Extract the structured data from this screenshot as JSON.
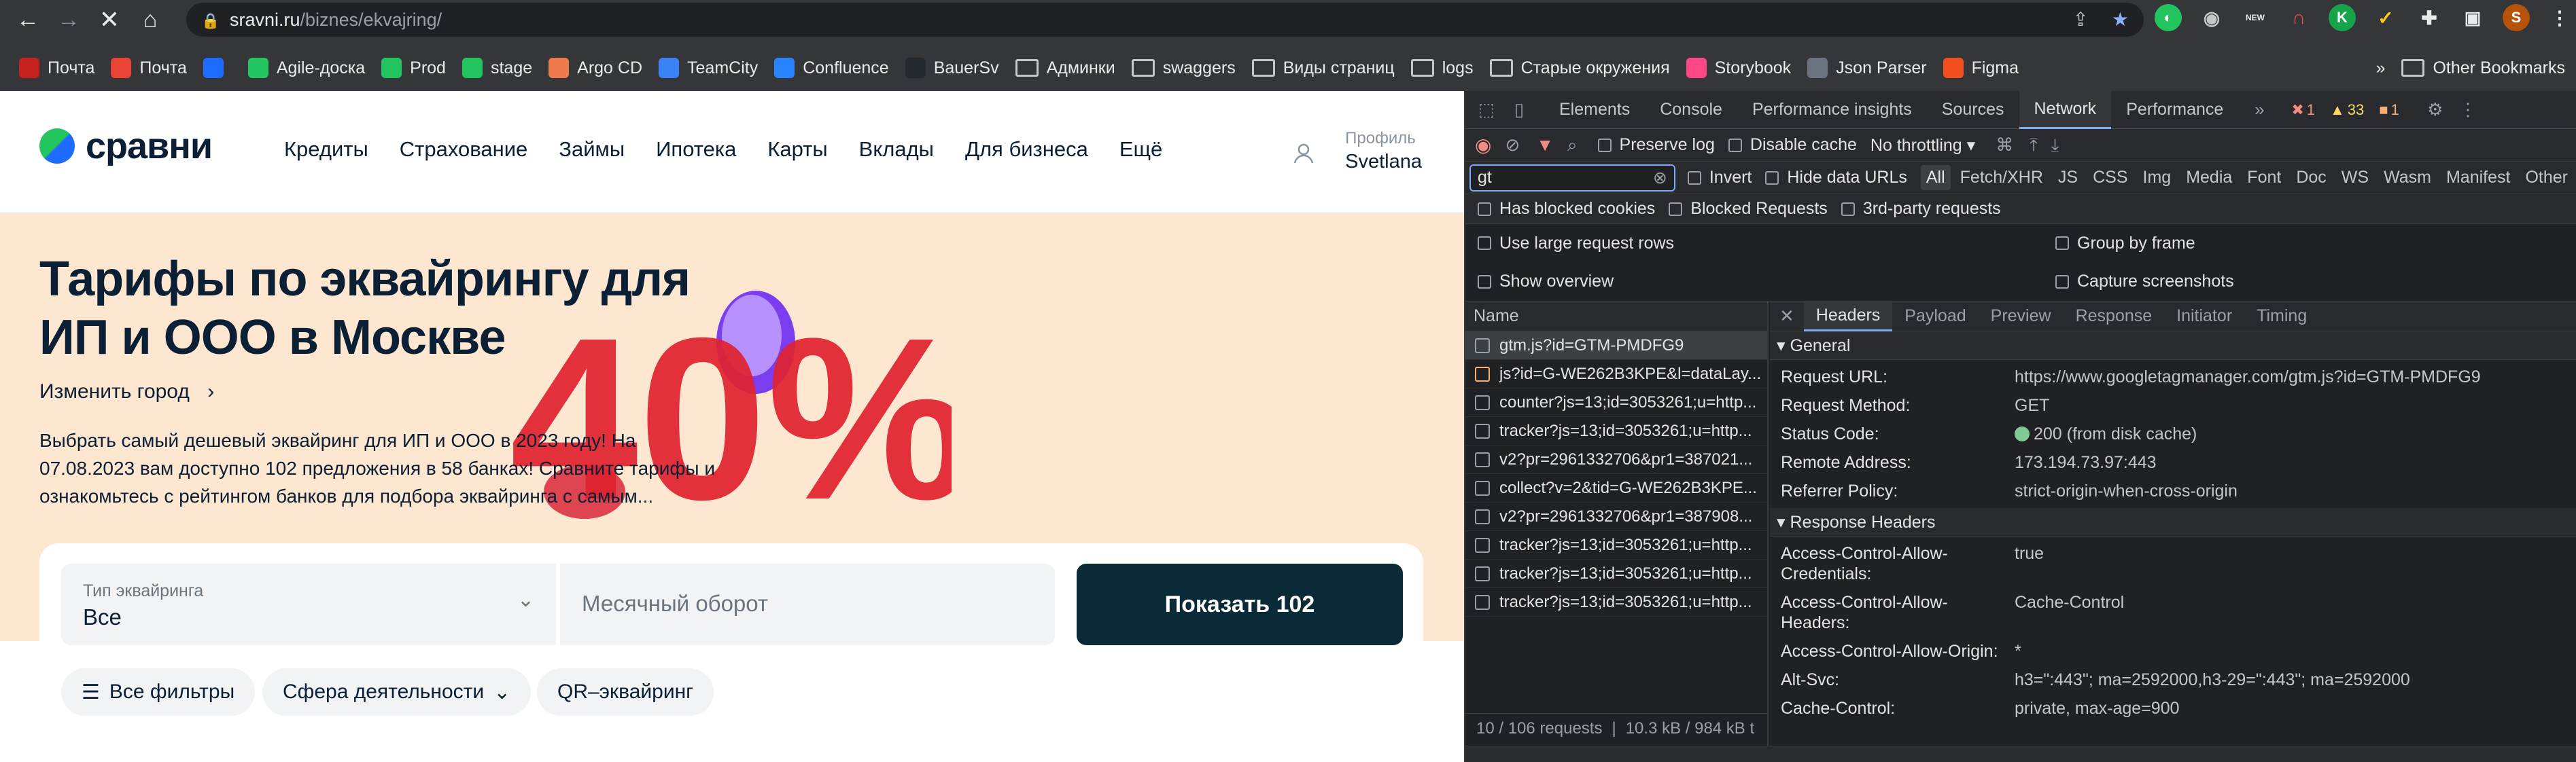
{
  "browser": {
    "url_host": "sravni.ru",
    "url_path": "/biznes/ekvajring/",
    "bookmarks": [
      {
        "label": "Почта",
        "color": "#c5221f",
        "icon": "gmail-icon"
      },
      {
        "label": "Почта",
        "color": "#ea4335",
        "icon": "gmail-icon"
      },
      {
        "label": "",
        "color": "#1e6bff",
        "icon": "jira-icon"
      },
      {
        "label": "Agile-доска",
        "color": "#22c55e",
        "icon": "sravni-icon"
      },
      {
        "label": "Prod",
        "color": "#22c55e",
        "icon": "sravni-icon"
      },
      {
        "label": "stage",
        "color": "#22c55e",
        "icon": "sravni-icon"
      },
      {
        "label": "Argo CD",
        "color": "#ef7b4d",
        "icon": "argo-icon"
      },
      {
        "label": "TeamCity",
        "color": "#3b82f6",
        "icon": "teamcity-icon"
      },
      {
        "label": "Confluence",
        "color": "#2684ff",
        "icon": "confluence-icon"
      },
      {
        "label": "BauerSv",
        "color": "#24292f",
        "icon": "github-icon"
      },
      {
        "label": "Админки",
        "color": "",
        "icon": "folder-icon"
      },
      {
        "label": "swaggers",
        "color": "",
        "icon": "folder-icon"
      },
      {
        "label": "Виды страниц",
        "color": "",
        "icon": "folder-icon"
      },
      {
        "label": "logs",
        "color": "",
        "icon": "folder-icon"
      },
      {
        "label": "Старые окружения",
        "color": "",
        "icon": "folder-icon"
      },
      {
        "label": "Storybook",
        "color": "#ff4785",
        "icon": "storybook-icon"
      },
      {
        "label": "Json Parser",
        "color": "#6b7280",
        "icon": "json-icon"
      },
      {
        "label": "Figma",
        "color": "#f24e1e",
        "icon": "figma-icon"
      }
    ],
    "more_bookmarks": "»",
    "other_bookmarks": "Other Bookmarks"
  },
  "site": {
    "logo": "сравни",
    "nav": [
      "Кредиты",
      "Страхование",
      "Займы",
      "Ипотека",
      "Карты",
      "Вклады",
      "Для бизнеса",
      "Ещё"
    ],
    "profile_label": "Профиль",
    "profile_name": "Svetlana",
    "hero_title": "Тарифы по эквайрингу для ИП и ООО в Москве",
    "change_city": "Изменить город",
    "hero_desc": "Выбрать самый дешевый эквайринг для ИП и ООО в 2023 году! На 07.08.2023 вам доступно 102 предложения в 58 банках! Сравните тарифы и ознакомьтесь с рейтингом банков для подбора эквайринга с самым...",
    "promo_text": "40%",
    "field_type_label": "Тип эквайринга",
    "field_type_value": "Все",
    "turnover_placeholder": "Месячный оборот",
    "show_button": "Показать 102",
    "chips": [
      "Все фильтры",
      "Сфера деятельности",
      "QR–эквайринг"
    ]
  },
  "devtools": {
    "tabs": [
      "Elements",
      "Console",
      "Performance insights",
      "Sources",
      "Network",
      "Performance"
    ],
    "active_tab": "Network",
    "errors": "1",
    "warnings": "33",
    "info": "1",
    "preserve_log": "Preserve log",
    "disable_cache": "Disable cache",
    "throttling": "No throttling",
    "filter_value": "gt",
    "invert": "Invert",
    "hide_data_urls": "Hide data URLs",
    "types": [
      "All",
      "Fetch/XHR",
      "JS",
      "CSS",
      "Img",
      "Media",
      "Font",
      "Doc",
      "WS",
      "Wasm",
      "Manifest",
      "Other"
    ],
    "has_blocked_cookies": "Has blocked cookies",
    "blocked_requests": "Blocked Requests",
    "third_party": "3rd-party requests",
    "large_rows": "Use large request rows",
    "group_by_frame": "Group by frame",
    "show_overview": "Show overview",
    "capture_screenshots": "Capture screenshots",
    "name_header": "Name",
    "requests": [
      "gtm.js?id=GTM-PMDFG9",
      "js?id=G-WE262B3KPE&l=dataLay...",
      "counter?js=13;id=3053261;u=http...",
      "tracker?js=13;id=3053261;u=http...",
      "v2?pr=2961332706&pr1=387021...",
      "collect?v=2&tid=G-WE262B3KPE...",
      "v2?pr=2961332706&pr1=387908...",
      "tracker?js=13;id=3053261;u=http...",
      "tracker?js=13;id=3053261;u=http...",
      "tracker?js=13;id=3053261;u=http..."
    ],
    "status_requests": "10 / 106 requests",
    "status_size": "10.3 kB / 984 kB t",
    "detail_tabs": [
      "Headers",
      "Payload",
      "Preview",
      "Response",
      "Initiator",
      "Timing"
    ],
    "general_title": "▾ General",
    "general": [
      {
        "k": "Request URL:",
        "v": "https://www.googletagmanager.com/gtm.js?id=GTM-PMDFG9"
      },
      {
        "k": "Request Method:",
        "v": "GET"
      },
      {
        "k": "Status Code:",
        "v": "200 (from disk cache)"
      },
      {
        "k": "Remote Address:",
        "v": "173.194.73.97:443"
      },
      {
        "k": "Referrer Policy:",
        "v": "strict-origin-when-cross-origin"
      }
    ],
    "response_title": "▾ Response Headers",
    "response": [
      {
        "k": "Access-Control-Allow-Credentials:",
        "v": "true"
      },
      {
        "k": "Access-Control-Allow-Headers:",
        "v": "Cache-Control"
      },
      {
        "k": "Access-Control-Allow-Origin:",
        "v": "*"
      },
      {
        "k": "Alt-Svc:",
        "v": "h3=\":443\"; ma=2592000,h3-29=\":443\"; ma=2592000"
      },
      {
        "k": "Cache-Control:",
        "v": "private, max-age=900"
      }
    ]
  }
}
